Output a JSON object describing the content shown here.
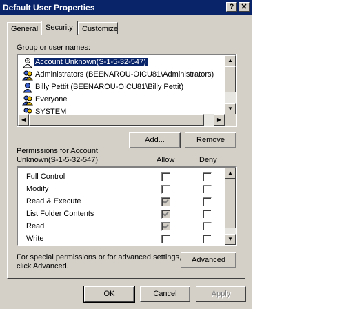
{
  "window": {
    "title": "Default User Properties",
    "help_glyph": "?",
    "close_glyph": "✕"
  },
  "tabs": [
    {
      "label": "General",
      "active": false
    },
    {
      "label": "Security",
      "active": true
    },
    {
      "label": "Customize",
      "active": false
    }
  ],
  "group_list": {
    "label": "Group or user names:",
    "items": [
      {
        "name": "Account Unknown(S-1-5-32-547)",
        "selected": true,
        "icon": "unknown-user-icon"
      },
      {
        "name": "Administrators (BEENAROU-OICU81\\Administrators)",
        "selected": false,
        "icon": "group-icon"
      },
      {
        "name": "Billy Pettit (BEENAROU-OICU81\\Billy Pettit)",
        "selected": false,
        "icon": "user-icon"
      },
      {
        "name": "Everyone",
        "selected": false,
        "icon": "group-icon"
      },
      {
        "name": "SYSTEM",
        "selected": false,
        "icon": "group-icon"
      }
    ]
  },
  "buttons": {
    "add": "Add...",
    "remove": "Remove",
    "advanced": "Advanced",
    "ok": "OK",
    "cancel": "Cancel",
    "apply": "Apply"
  },
  "permissions": {
    "label_line1": "Permissions for Account",
    "label_line2": "Unknown(S-1-5-32-547)",
    "allow_header": "Allow",
    "deny_header": "Deny",
    "rows": [
      {
        "name": "Full Control",
        "allow": false,
        "deny": false,
        "inherited": false
      },
      {
        "name": "Modify",
        "allow": false,
        "deny": false,
        "inherited": false
      },
      {
        "name": "Read & Execute",
        "allow": true,
        "deny": false,
        "inherited": true
      },
      {
        "name": "List Folder Contents",
        "allow": true,
        "deny": false,
        "inherited": true
      },
      {
        "name": "Read",
        "allow": true,
        "deny": false,
        "inherited": true
      },
      {
        "name": "Write",
        "allow": false,
        "deny": false,
        "inherited": false
      }
    ]
  },
  "advanced_note": {
    "line1": "For special permissions or for advanced settings,",
    "line2": "click Advanced."
  },
  "colors": {
    "titlebar": "#0a246a",
    "face": "#d4d0c8",
    "selection": "#0a246a"
  }
}
